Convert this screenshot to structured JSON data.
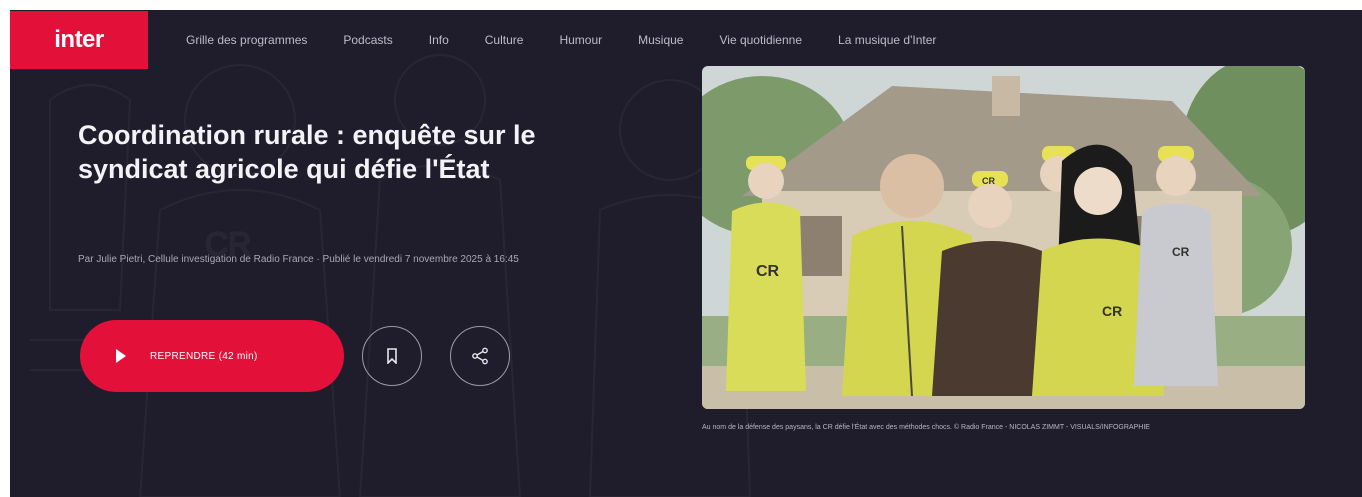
{
  "brand": {
    "logo_text": "inter",
    "accent": "#e3103a",
    "background": "#1f1d2b"
  },
  "nav": {
    "items": [
      {
        "label": "Grille des programmes"
      },
      {
        "label": "Podcasts"
      },
      {
        "label": "Info"
      },
      {
        "label": "Culture"
      },
      {
        "label": "Humour"
      },
      {
        "label": "Musique"
      },
      {
        "label": "Vie quotidienne"
      },
      {
        "label": "La musique d'Inter"
      }
    ]
  },
  "hero": {
    "title": "Coordination rurale : enquête sur le syndicat agricole qui défie l'État",
    "byline": "Par Julie Pietri, Cellule investigation de Radio France · Publié le vendredi 7 novembre 2025 à 16:45",
    "play_label": "REPRENDRE (42 min)",
    "play_icon": "play-icon",
    "bookmark_icon": "bookmark-icon",
    "share_icon": "share-icon"
  },
  "image": {
    "caption": "Au nom de la défense des paysans, la CR défie l'État avec des méthodes chocs. © Radio France - NICOLAS ZIMMT - VISUALS/INFOGRAPHIE"
  }
}
